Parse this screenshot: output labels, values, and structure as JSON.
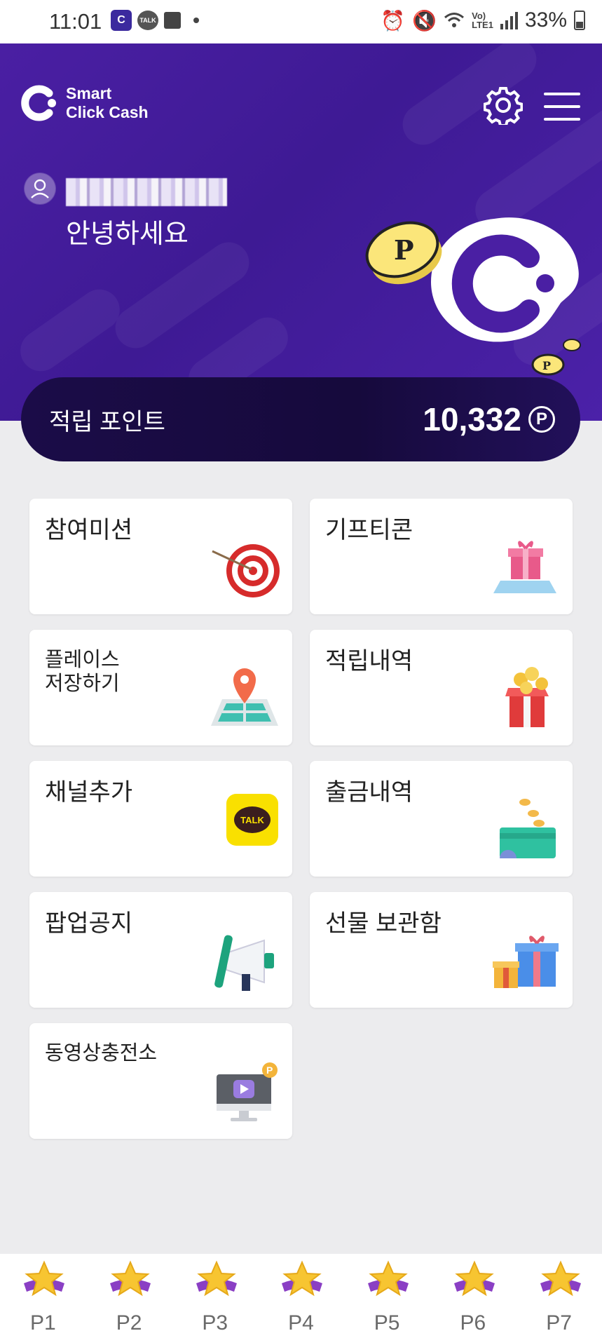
{
  "status_bar": {
    "time": "11:01",
    "battery": "33%",
    "talk_badge": "TALK",
    "icons": [
      "clickcash-app-icon",
      "kakaotalk-icon",
      "calendar-icon",
      "dot-icon",
      "alarm-icon",
      "mute-icon",
      "wifi-icon",
      "volte-icon",
      "signal-icon",
      "battery-icon"
    ]
  },
  "header": {
    "logo_line1": "Smart",
    "logo_line2": "Click Cash",
    "username_redacted": true,
    "greeting": "안녕하세요"
  },
  "points": {
    "label": "적립 포인트",
    "value": "10,332",
    "unit_symbol": "P"
  },
  "menu": [
    {
      "label": "참여미션",
      "icon": "target-icon"
    },
    {
      "label": "기프티콘",
      "icon": "gift-box-icon"
    },
    {
      "label_line1": "플레이스",
      "label_line2": "저장하기",
      "icon": "map-pin-icon"
    },
    {
      "label": "적립내역",
      "icon": "coin-giftbox-icon"
    },
    {
      "label": "채널추가",
      "icon": "kakao-talk-icon",
      "talk_text": "TALK"
    },
    {
      "label": "출금내역",
      "icon": "wallet-icon"
    },
    {
      "label": "팝업공지",
      "icon": "megaphone-icon"
    },
    {
      "label": "선물 보관함",
      "icon": "presents-icon"
    },
    {
      "label": "동영상충전소",
      "icon": "video-monitor-icon"
    }
  ],
  "bottom_nav": [
    "P1",
    "P2",
    "P3",
    "P4",
    "P5",
    "P6",
    "P7"
  ],
  "colors": {
    "header_purple": "#4a1fa3",
    "points_bar": "#1b0c48",
    "page_bg": "#ececee"
  }
}
